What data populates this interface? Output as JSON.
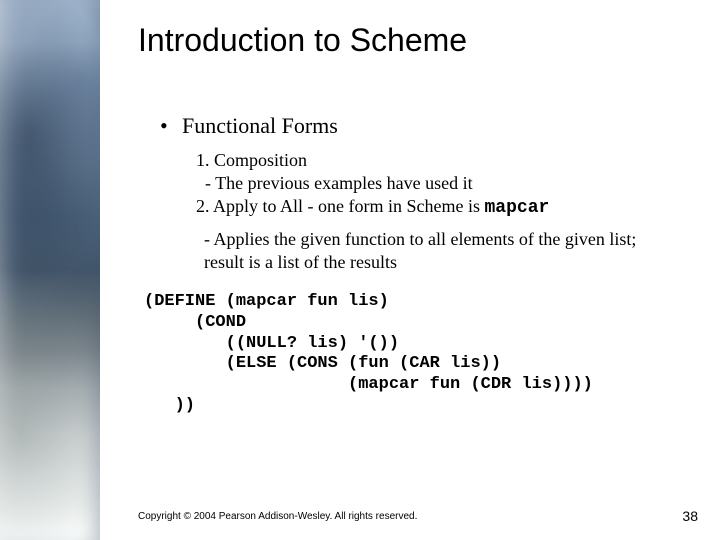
{
  "title": "Introduction to Scheme",
  "bullet": "Functional Forms",
  "lines": {
    "l1": "1. Composition",
    "l2": "  - The previous examples have used it",
    "l3a": "2. Apply to All - one form in Scheme is ",
    "l3b": "mapcar",
    "d1": " - Applies the given function to all elements of the given list;",
    "d2": "result is a list of the results"
  },
  "code": "(DEFINE (mapcar fun lis)\n     (COND\n        ((NULL? lis) '())\n        (ELSE (CONS (fun (CAR lis))\n                    (mapcar fun (CDR lis))))\n   ))",
  "footer": "Copyright © 2004 Pearson Addison-Wesley. All rights reserved.",
  "slide_number": "38"
}
